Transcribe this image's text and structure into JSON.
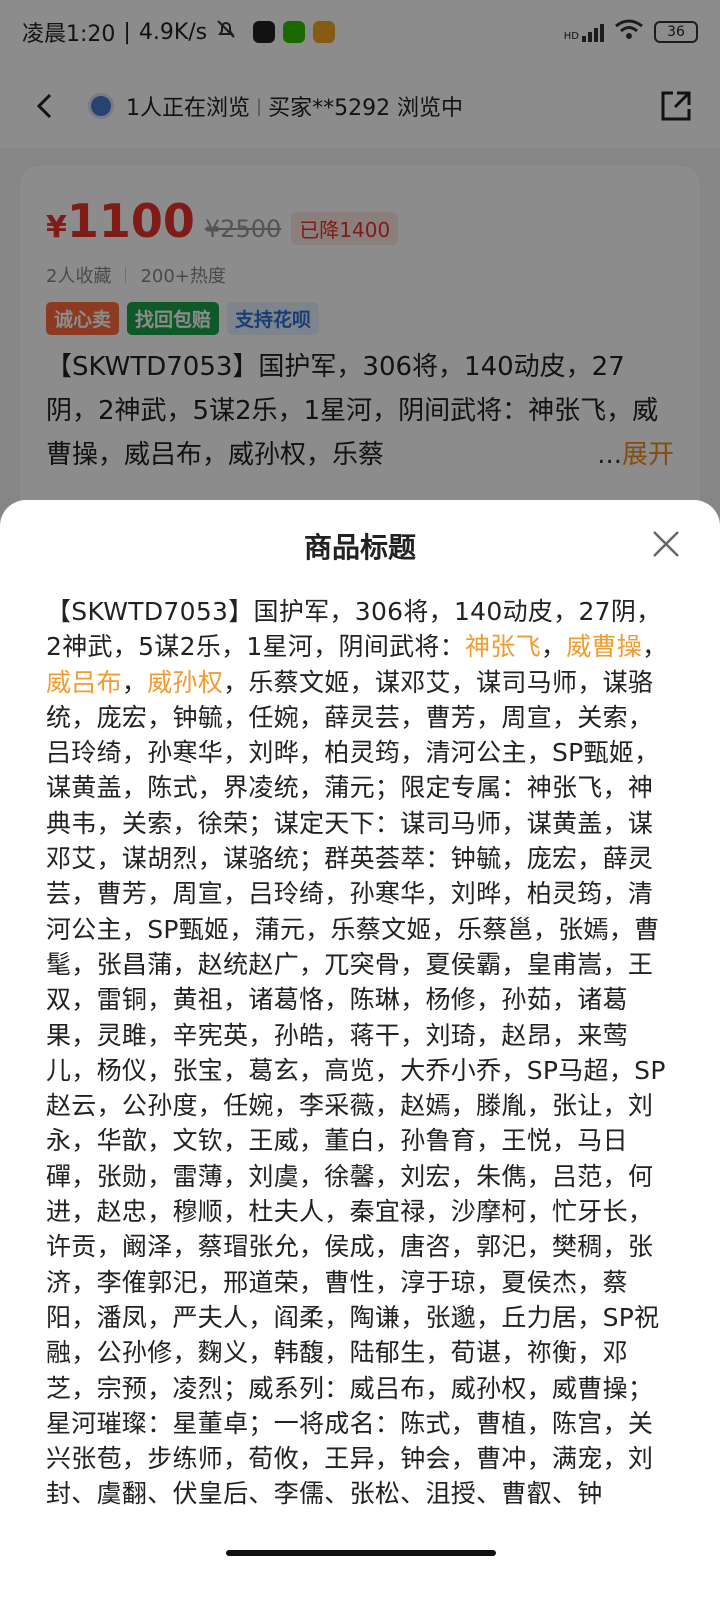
{
  "status_bar": {
    "time": "凌晨1:20",
    "speed": "4.9K/s",
    "battery": "36",
    "network_label": "HD"
  },
  "nav": {
    "browsing": "1人正在浏览",
    "buyer": "买家**5292 浏览中"
  },
  "card": {
    "currency": "¥",
    "price": "1100",
    "original_price": "¥2500",
    "drop_label": "已降1400",
    "favorites": "2人收藏",
    "heat": "200+热度",
    "tags": [
      "诚心卖",
      "找回包赔",
      "支持花呗"
    ],
    "title_preview": "【SKWTD7053】国护军，306将，140动皮，27阴，2神武，5谋2乐，1星河，阴间武将：神张飞，威曹操，威吕布，威孙权，乐蔡",
    "expand_prefix": "...",
    "expand_label": "展开"
  },
  "sheet": {
    "title": "商品标题",
    "body_before": "【SKWTD7053】国护军，306将，140动皮，27阴，2神武，5谋2乐，1星河，阴间武将：",
    "hl_1": "神张飞",
    "sep_1": "，",
    "hl_2": "威曹操",
    "sep_2": "，",
    "hl_3": "威吕布",
    "sep_3": "，",
    "hl_4": "威孙权",
    "body_after": "，乐蔡文姬，谋邓艾，谋司马师，谋骆统，庞宏，钟毓，任婉，薛灵芸，曹芳，周宣，关索，吕玲绮，孙寒华，刘晔，柏灵筠，清河公主，SP甄姬，谋黄盖，陈式，界凌统，蒲元；限定专属：神张飞，神典韦，关索，徐荣；谋定天下：谋司马师，谋黄盖，谋邓艾，谋胡烈，谋骆统；群英荟萃：钟毓，庞宏，薛灵芸，曹芳，周宣，吕玲绮，孙寒华，刘晔，柏灵筠，清河公主，SP甄姬，蒲元，乐蔡文姬，乐蔡邕，张嫣，曹髦，张昌蒲，赵统赵广，兀突骨，夏侯霸，皇甫嵩，王双，雷铜，黄祖，诸葛恪，陈琳，杨修，孙茹，诸葛果，灵雎，辛宪英，孙皓，蒋干，刘琦，赵昂，来莺儿，杨仪，张宝，葛玄，高览，大乔小乔，SP马超，SP赵云，公孙度，任婉，李采薇，赵嫣，滕胤，张让，刘永，华歆，文钦，王威，董白，孙鲁育，王悦，马日磾，张勋，雷薄，刘虞，徐馨，刘宏，朱儁，吕范，何进，赵忠，穆顺，杜夫人，秦宜禄，沙摩柯，忙牙长，许贡，阚泽，蔡瑁张允，侯成，唐咨，郭汜，樊稠，张济，李傕郭汜，邢道荣，曹性，淳于琼，夏侯杰，蔡阳，潘凤，严夫人，阎柔，陶谦，张邈，丘力居，SP祝融，公孙修，麴义，韩馥，陆郁生，荀谌，祢衡，邓芝，宗预，凌烈；威系列：威吕布，威孙权，威曹操；星河璀璨：星董卓；一将成名：陈式，曹植，陈宫，关兴张苞，步练师，荀攸，王异，钟会，曹冲，满宠，刘封、虞翻、伏皇后、李儒、张松、沮授、曹叡、钟"
  },
  "colors": {
    "price": "#e8342b",
    "highlight": "#f29b2f",
    "expand": "#f08a1c"
  }
}
